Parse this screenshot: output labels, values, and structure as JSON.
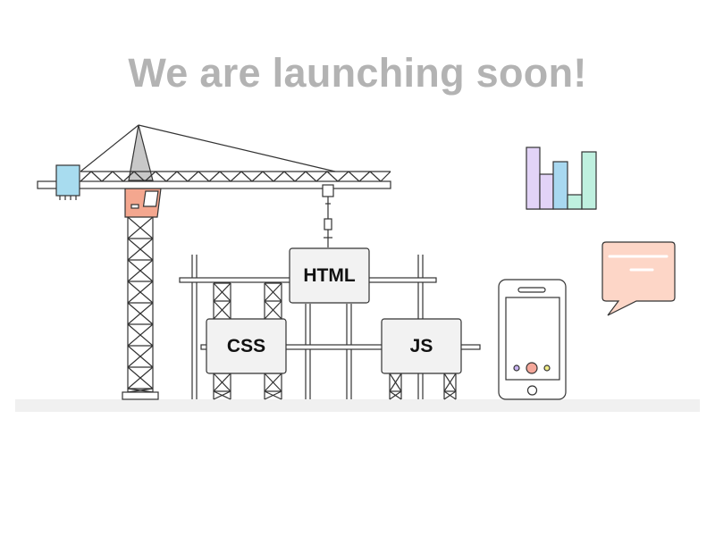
{
  "page": {
    "headline": "We are launching soon!"
  },
  "blocks": {
    "html": "HTML",
    "css": "CSS",
    "js": "JS"
  },
  "colors": {
    "headline": "#b3b3b3",
    "outline": "#333333",
    "ground": "#f0f0f0",
    "crane_cab": "#f4a78f",
    "crane_counterweight": "#a8dcef",
    "crane_mast_top": "#c8c8c8",
    "block_fill": "#f2f2f2",
    "chart_bar_1": "#e2d3f7",
    "chart_bar_2": "#a8d8f0",
    "chart_bar_3": "#bff0df",
    "chat_bubble": "#fdd6c7",
    "phone_button": "#f4a79a",
    "phone_dot_left": "#c7b2f0",
    "phone_dot_right": "#f1ed86"
  },
  "icons": {
    "chart": "bar-chart-icon",
    "chat": "chat-bubble-icon",
    "phone": "smartphone-icon",
    "crane": "tower-crane-icon"
  }
}
